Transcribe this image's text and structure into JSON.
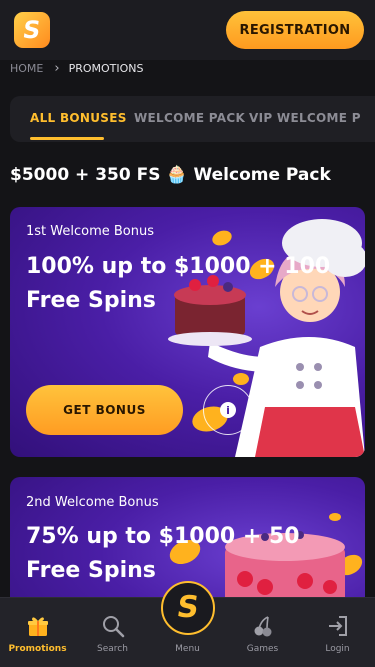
{
  "header": {
    "logo_icon": "brand-s-logo",
    "registration_label": "REGISTRATION"
  },
  "breadcrumb": {
    "home": "HOME",
    "separator_icon": "chevron-right-icon",
    "current": "PROMOTIONS"
  },
  "tabs": [
    {
      "label": "ALL BONUSES",
      "active": true
    },
    {
      "label": "WELCOME PACK",
      "active": false
    },
    {
      "label": "VIP WELCOME P",
      "active": false
    }
  ],
  "pack_title": "$5000 + 350 FS 🧁 Welcome Pack",
  "bonuses": [
    {
      "label": "1st Welcome Bonus",
      "headline": "100% up to $1000 + 100 Free Spins",
      "cta": "GET BONUS",
      "info_icon": "info-icon"
    },
    {
      "label": "2nd Welcome Bonus",
      "headline": "75% up to $1000 + 50 Free Spins"
    }
  ],
  "bottom_nav": [
    {
      "label": "Promotions",
      "icon": "gift-icon",
      "active": true
    },
    {
      "label": "Search",
      "icon": "search-icon",
      "active": false
    },
    {
      "label": "Menu",
      "icon": "brand-s-logo",
      "active": false
    },
    {
      "label": "Games",
      "icon": "cherries-icon",
      "active": false
    },
    {
      "label": "Login",
      "icon": "login-icon",
      "active": false
    }
  ],
  "colors": {
    "accent": "#ffbe2e",
    "background": "#141417",
    "card_purple": "#4a1ea6"
  }
}
